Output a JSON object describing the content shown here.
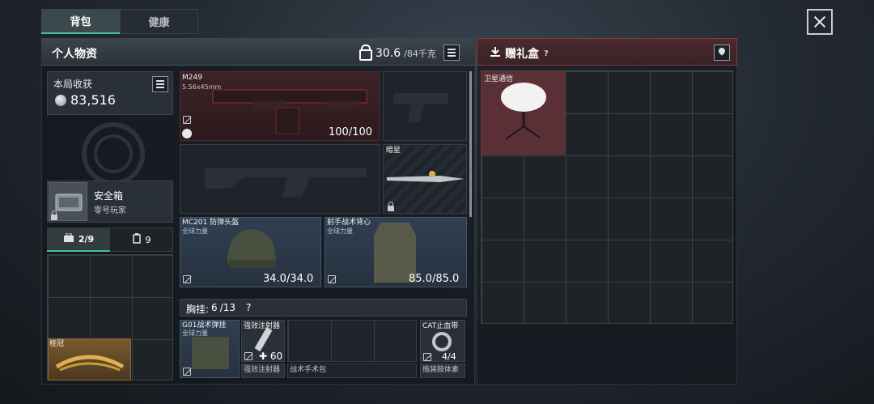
{
  "tabs": [
    {
      "label": "背包"
    },
    {
      "label": "健康"
    }
  ],
  "personal": {
    "title": "个人物资",
    "weight_current": "30.6",
    "weight_max": "/84千克"
  },
  "income": {
    "title": "本局收获",
    "value": "83,516"
  },
  "safebox": {
    "name": "安全箱",
    "sub": "零号玩家"
  },
  "bag_tabs": [
    {
      "label": "2/9",
      "icon": "backpack-icon"
    },
    {
      "label": "9",
      "icon": "rig-icon"
    }
  ],
  "weapons": {
    "primary": {
      "name": "M249",
      "caliber": "5.56x45mm",
      "durability": "100/100"
    },
    "melee": {
      "name": "暗星"
    }
  },
  "helmet": {
    "name": "MC201 防弹头盔",
    "brand": "全球力量",
    "durability": "34.0/34.0"
  },
  "vest": {
    "name": "射手战术背心",
    "brand": "全球力量",
    "durability": "85.0/85.0"
  },
  "chest_rig": {
    "label": "胸挂:",
    "count": "6",
    "max": "/13"
  },
  "rig_items": [
    {
      "name": "G01战术弹挂",
      "brand": "全球力量"
    },
    {
      "name": "强效注射器",
      "count": "60",
      "sub": "强效注射器"
    },
    {
      "name": "战术手术包"
    },
    {
      "name": "CAT止血带",
      "count": "4/4",
      "sub": "瓶装肢体素"
    }
  ],
  "laurel": {
    "name": "桂冠"
  },
  "gift": {
    "title": "赠礼盒",
    "help": "?",
    "item": "卫星通信"
  },
  "colors": {
    "accent": "#3fc3a3",
    "gift_red": "#8a3a40"
  }
}
